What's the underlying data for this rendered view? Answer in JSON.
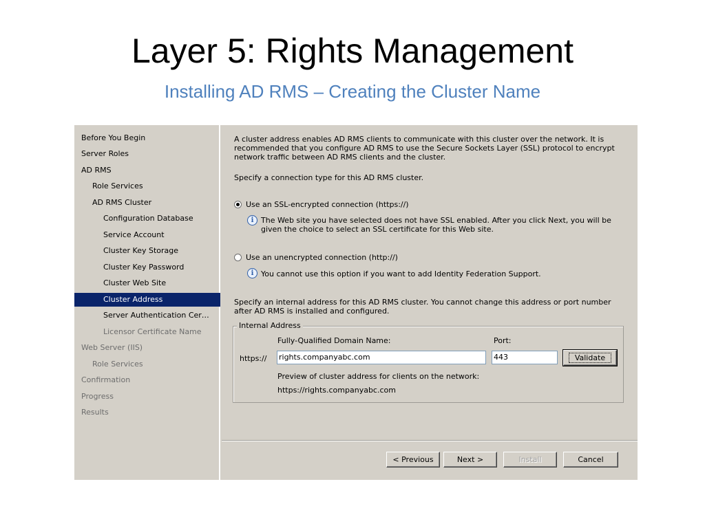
{
  "slide": {
    "title": "Layer 5: Rights Management",
    "subtitle": "Installing AD RMS – Creating the Cluster Name"
  },
  "nav": {
    "items": [
      {
        "label": "Before You Begin",
        "level": 0,
        "state": "normal"
      },
      {
        "label": "Server Roles",
        "level": 0,
        "state": "normal"
      },
      {
        "label": "AD RMS",
        "level": 0,
        "state": "normal"
      },
      {
        "label": "Role Services",
        "level": 1,
        "state": "normal"
      },
      {
        "label": "AD RMS Cluster",
        "level": 1,
        "state": "normal"
      },
      {
        "label": "Configuration Database",
        "level": 2,
        "state": "normal"
      },
      {
        "label": "Service Account",
        "level": 2,
        "state": "normal"
      },
      {
        "label": "Cluster Key Storage",
        "level": 2,
        "state": "normal"
      },
      {
        "label": "Cluster Key Password",
        "level": 2,
        "state": "normal"
      },
      {
        "label": "Cluster Web Site",
        "level": 2,
        "state": "normal"
      },
      {
        "label": "Cluster Address",
        "level": 2,
        "state": "active"
      },
      {
        "label": "Server Authentication Certificate",
        "level": 2,
        "state": "normal"
      },
      {
        "label": "Licensor Certificate Name",
        "level": 2,
        "state": "dim"
      },
      {
        "label": "Web Server (IIS)",
        "level": 0,
        "state": "dim"
      },
      {
        "label": "Role Services",
        "level": 1,
        "state": "dim"
      },
      {
        "label": "Confirmation",
        "level": 0,
        "state": "dim"
      },
      {
        "label": "Progress",
        "level": 0,
        "state": "dim"
      },
      {
        "label": "Results",
        "level": 0,
        "state": "dim"
      }
    ]
  },
  "content": {
    "intro": "A cluster address enables AD RMS clients to communicate with this cluster over the network. It is recommended that you configure AD RMS to use the Secure Sockets Layer (SSL) protocol to encrypt network traffic between AD RMS clients and the cluster.",
    "connection_prompt": "Specify a connection type for this AD RMS cluster.",
    "ssl_option": {
      "label": "Use an SSL-encrypted connection (https://)",
      "selected": true,
      "info": "The Web site you have selected does not have SSL enabled. After you click Next, you will be given the choice to select an SSL certificate for this Web site."
    },
    "http_option": {
      "label": "Use an unencrypted connection (http://)",
      "selected": false,
      "info": "You cannot use this option if you want to add Identity Federation Support."
    },
    "address_prompt": "Specify an internal address for this AD RMS cluster. You cannot change this address or port number after AD RMS is installed and configured.",
    "internal_address": {
      "legend": "Internal Address",
      "fqdn_label": "Fully-Qualified Domain Name:",
      "port_label": "Port:",
      "scheme": "https://",
      "fqdn_value": "rights.companyabc.com",
      "port_value": "443",
      "validate_label": "Validate",
      "preview_label": "Preview of cluster address for clients on the network:",
      "preview_value": "https://rights.companyabc.com"
    }
  },
  "footer": {
    "previous_label": "< Previous",
    "next_label": "Next >",
    "install_label": "Install",
    "cancel_label": "Cancel"
  },
  "icons": {
    "info": "information-icon"
  },
  "colors": {
    "selection": "#0a246a",
    "dialog_bg": "#d4d0c8",
    "subtitle": "#4f81bd"
  }
}
